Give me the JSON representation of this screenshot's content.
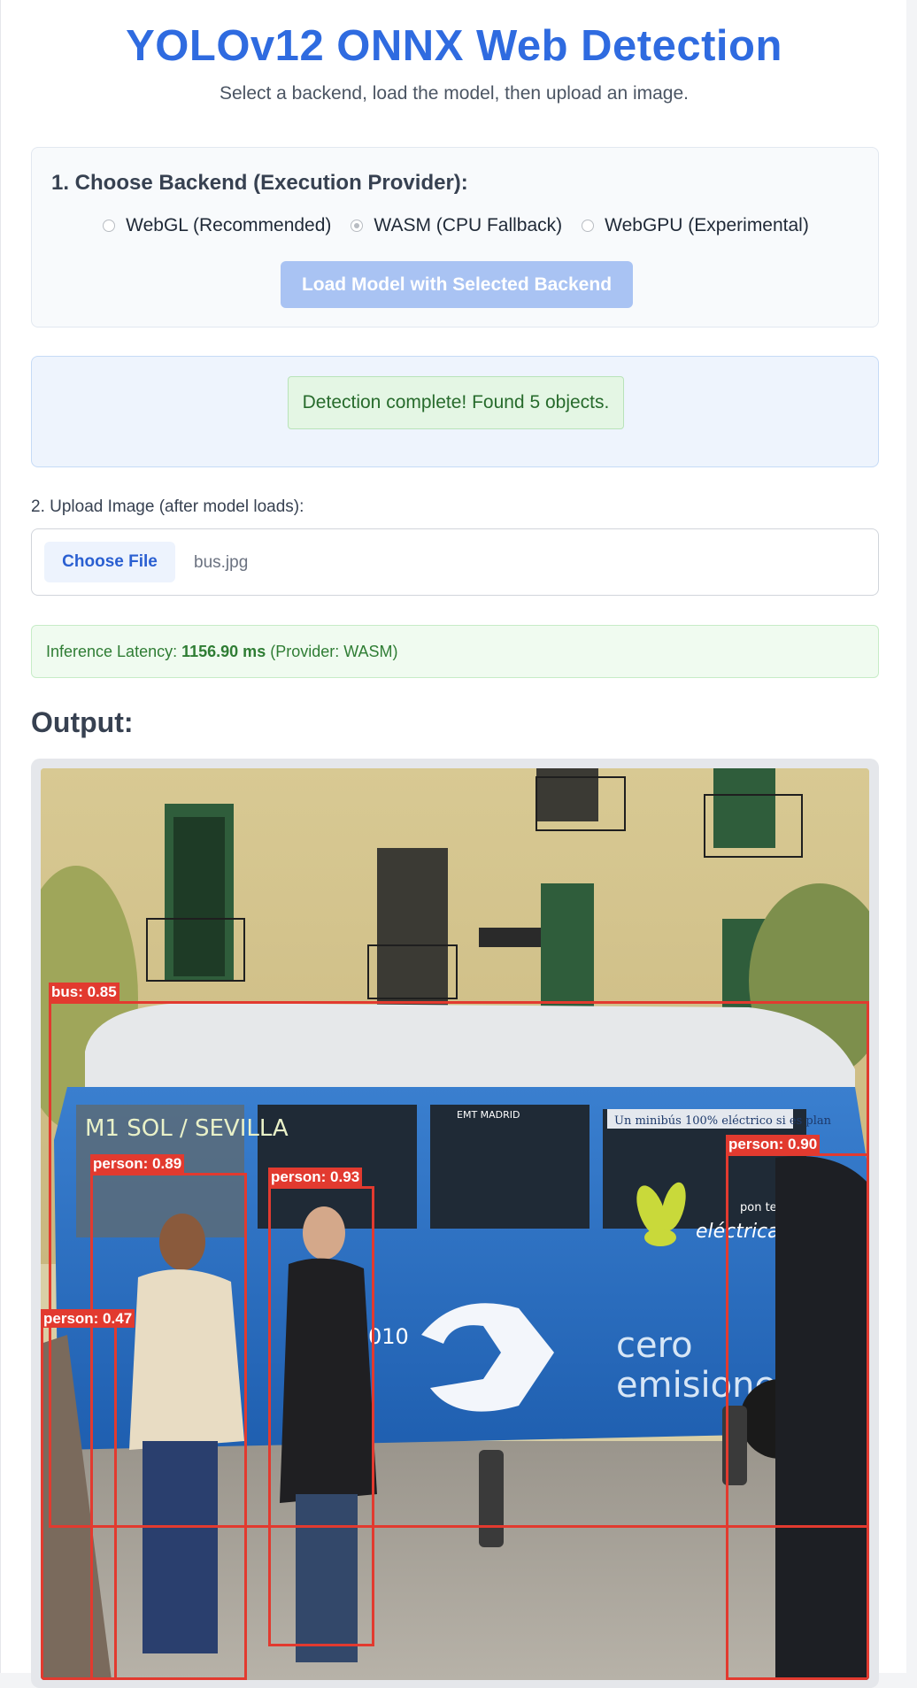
{
  "header": {
    "title": "YOLOv12 ONNX Web Detection",
    "subtitle": "Select a backend, load the model, then upload an image."
  },
  "backend": {
    "heading": "1. Choose Backend (Execution Provider):",
    "options": [
      {
        "label": "WebGL (Recommended)",
        "checked": false
      },
      {
        "label": "WASM (CPU Fallback)",
        "checked": true
      },
      {
        "label": "WebGPU (Experimental)",
        "checked": false
      }
    ],
    "load_button": "Load Model with Selected Backend"
  },
  "status": {
    "message": "Detection complete! Found 5 objects."
  },
  "upload": {
    "label": "2. Upload Image (after model loads):",
    "button": "Choose File",
    "file_name": "bus.jpg"
  },
  "latency": {
    "prefix": "Inference Latency:",
    "value": "1156.90 ms",
    "suffix": "(Provider: WASM)"
  },
  "output": {
    "heading": "Output:",
    "detections": [
      {
        "label": "bus: 0.85"
      },
      {
        "label": "person: 0.89"
      },
      {
        "label": "person: 0.93"
      },
      {
        "label": "person: 0.90"
      },
      {
        "label": "person: 0.47"
      }
    ],
    "image_text": {
      "destination_sign": "M1 SOL / SEVILLA",
      "side_banner": "Un minibús 100% eléctrico si es plan",
      "brand": "eléctricamEMTe",
      "brand_tag": "pon te de",
      "operator": "EMT MADRID",
      "slogan_line1": "cero",
      "slogan_line2": "emisiones",
      "fleet_number": "010"
    },
    "box_color": "#e23a2f"
  }
}
